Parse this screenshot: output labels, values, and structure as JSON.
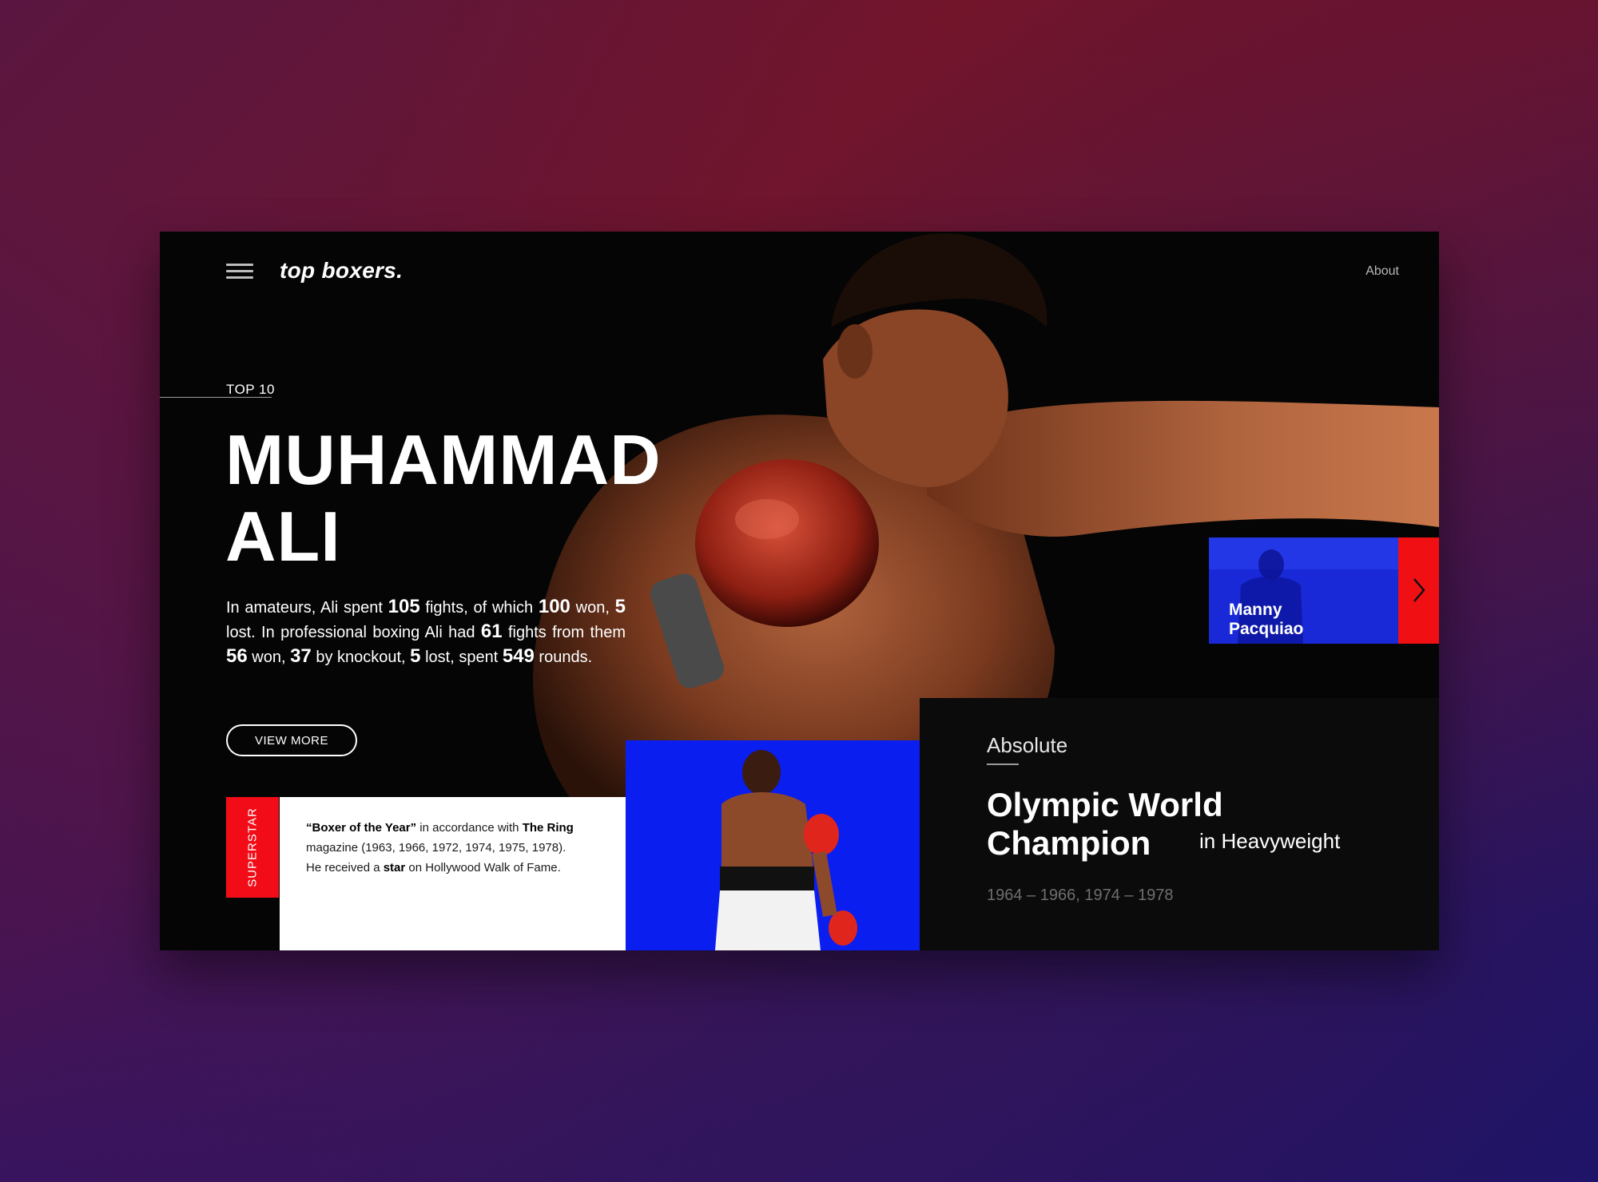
{
  "nav": {
    "logo": "top boxers.",
    "about": "About"
  },
  "hero": {
    "eyebrow": "TOP 10",
    "first_name": "MUHAMMAD",
    "last_name": "ALI",
    "bio": {
      "t1": "In amateurs, Ali spent ",
      "n1": "105",
      "t2": " fights, of which ",
      "n2": "100",
      "t3": " won, ",
      "n3": "5",
      "t4": " lost. In professional boxing Ali had ",
      "n4": "61",
      "t5": " fights from them ",
      "n5": "56",
      "t6": " won, ",
      "n6": "37",
      "t7": " by knockout, ",
      "n7": "5",
      "t8": " lost, spent ",
      "n8": "549",
      "t9": " rounds."
    },
    "cta": "VIEW MORE"
  },
  "superstar": {
    "tab": "SUPERSTAR",
    "b1": "“Boxer of the Year”",
    "t1": " in accordance with ",
    "b2": "The Ring",
    "t2": " magazine (1963, 1966, 1972, 1974, 1975, 1978).",
    "t3": "He received a ",
    "b3": "star",
    "t4": " on Hollywood Walk of Fame."
  },
  "achievement": {
    "kicker": "Absolute",
    "title": "Olympic World Champion",
    "suffix": "in Heavyweight",
    "years": "1964 – 1966, 1974 – 1978"
  },
  "next": {
    "line1": "Manny",
    "line2": "Pacquiao"
  },
  "colors": {
    "accent_red": "#f10c18",
    "panel_blue": "#0a1ef0",
    "card_bg": "#050505"
  }
}
